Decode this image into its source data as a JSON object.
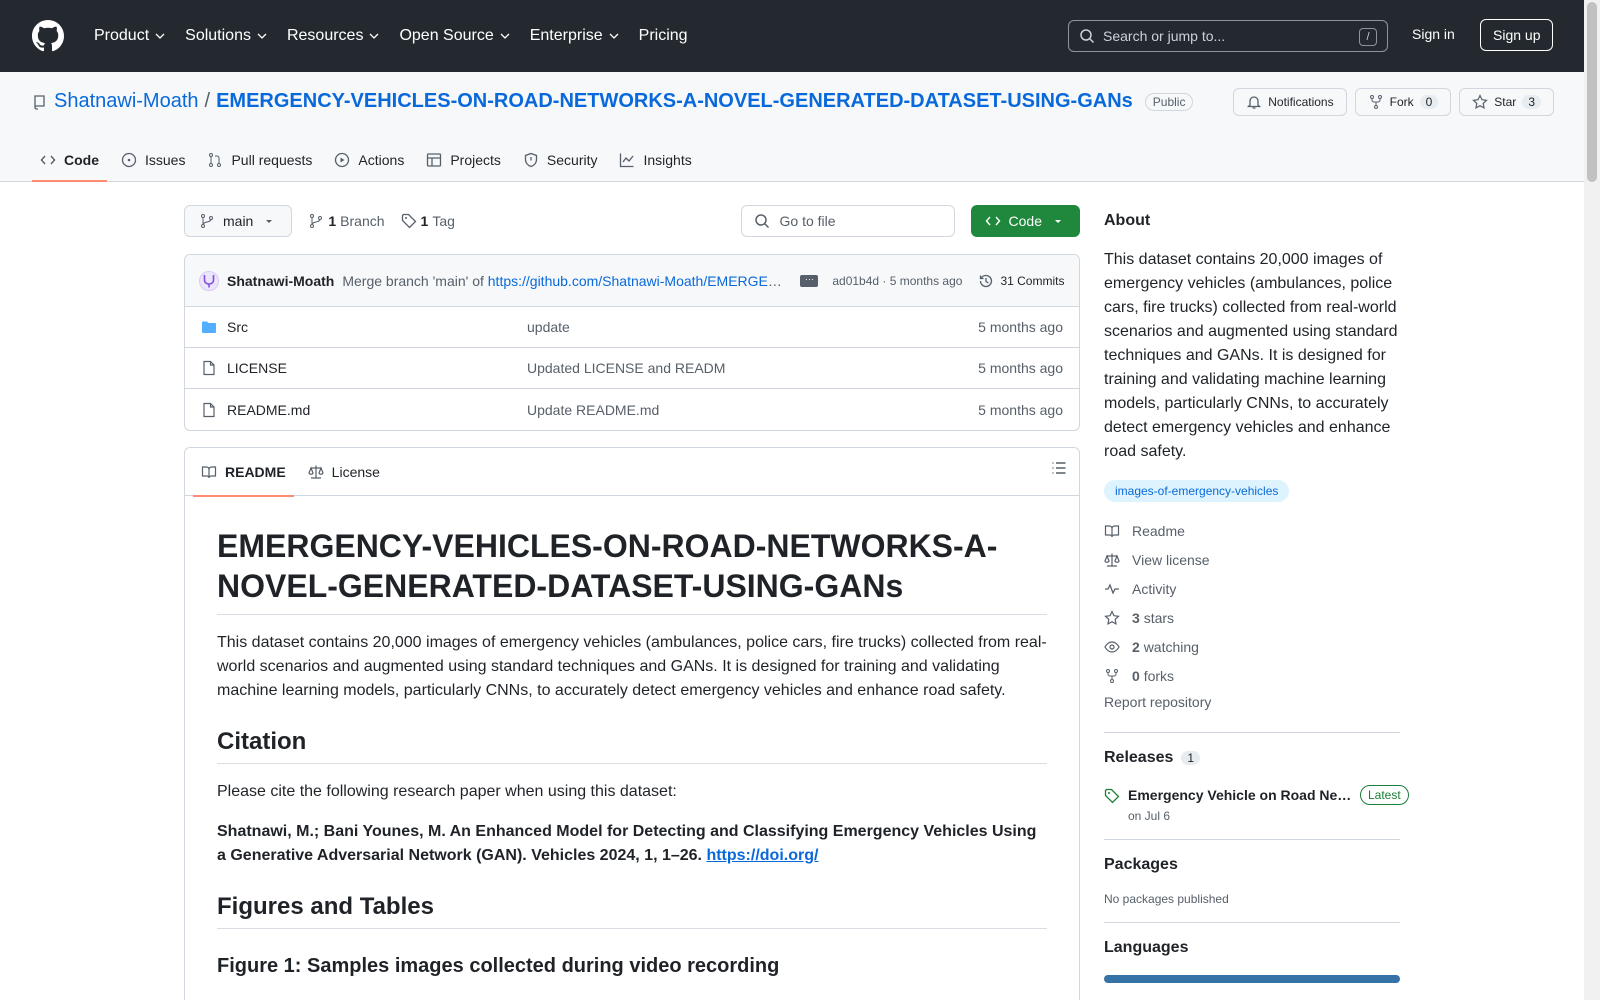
{
  "header": {
    "nav": [
      "Product",
      "Solutions",
      "Resources",
      "Open Source",
      "Enterprise",
      "Pricing"
    ],
    "search_placeholder": "Search or jump to...",
    "search_shortcut": "/",
    "sign_in": "Sign in",
    "sign_up": "Sign up"
  },
  "repo": {
    "owner": "Shatnawi-Moath",
    "separator": "/",
    "name": "EMERGENCY-VEHICLES-ON-ROAD-NETWORKS-A-NOVEL-GENERATED-DATASET-USING-GANs",
    "visibility": "Public",
    "notifications_label": "Notifications",
    "fork_label": "Fork",
    "fork_count": "0",
    "star_label": "Star",
    "star_count": "3",
    "tabs": [
      "Code",
      "Issues",
      "Pull requests",
      "Actions",
      "Projects",
      "Security",
      "Insights"
    ]
  },
  "toolbar": {
    "branch": "main",
    "branch_count": "1",
    "branch_label": "Branch",
    "tag_count": "1",
    "tag_label": "Tag",
    "goto_placeholder": "Go to file",
    "code_label": "Code"
  },
  "latest_commit": {
    "author": "Shatnawi-Moath",
    "message_prefix": "Merge branch 'main' of",
    "message_link": "https://github.com/Shatnawi-Moath/EMERGENCY-VEHICLES-ON-ROAD-NETWORKS-A-NOVEL-GENERATED-DATASET-USING-GANs",
    "sha": "ad01b4d",
    "time": "· 5 months ago",
    "commits_count": "31 Commits"
  },
  "files": [
    {
      "name": "Src",
      "type": "folder",
      "commit": "update",
      "date": "5 months ago"
    },
    {
      "name": "LICENSE",
      "type": "file",
      "commit": "Updated LICENSE and READM",
      "date": "5 months ago"
    },
    {
      "name": "README.md",
      "type": "file",
      "commit": "Update README.md",
      "date": "5 months ago"
    }
  ],
  "readme": {
    "tabs": [
      "README",
      "License"
    ],
    "title": "EMERGENCY-VEHICLES-ON-ROAD-NETWORKS-A-NOVEL-GENERATED-DATASET-USING-GANs",
    "intro": "This dataset contains 20,000 images of emergency vehicles (ambulances, police cars, fire trucks) collected from real-world scenarios and augmented using standard techniques and GANs. It is designed for training and validating machine learning models, particularly CNNs, to accurately detect emergency vehicles and enhance road safety.",
    "citation_heading": "Citation",
    "citation_text": "Please cite the following research paper when using this dataset:",
    "citation_ref": "Shatnawi, M.; Bani Younes, M. An Enhanced Model for Detecting and Classifying Emergency Vehicles Using a Generative Adversarial Network (GAN). Vehicles 2024, 1, 1–26.",
    "citation_link": "https://doi.org/",
    "figures_heading": "Figures and Tables",
    "figure1_heading": "Figure 1: Samples images collected during video recording"
  },
  "about": {
    "heading": "About",
    "description": "This dataset contains 20,000 images of emergency vehicles (ambulances, police cars, fire trucks) collected from real-world scenarios and augmented using standard techniques and GANs. It is designed for training and validating machine learning models, particularly CNNs, to accurately detect emergency vehicles and enhance road safety.",
    "topic": "images-of-emergency-vehicles",
    "readme": "Readme",
    "license": "View license",
    "activity": "Activity",
    "stars_count": "3",
    "stars_label": "stars",
    "watching_count": "2",
    "watching_label": "watching",
    "forks_count": "0",
    "forks_label": "forks",
    "report": "Report repository"
  },
  "releases": {
    "heading": "Releases",
    "count": "1",
    "name": "Emergency Vehicle on Road Networks",
    "badge": "Latest",
    "date": "on Jul 6"
  },
  "packages": {
    "heading": "Packages",
    "empty": "No packages published"
  },
  "languages": {
    "heading": "Languages",
    "bar_color": "#3572a5"
  },
  "colors": {
    "header_bg": "#24292f",
    "accent_link": "#0969da",
    "primary_button": "#1f883d",
    "tab_underline": "#fd8c73"
  }
}
